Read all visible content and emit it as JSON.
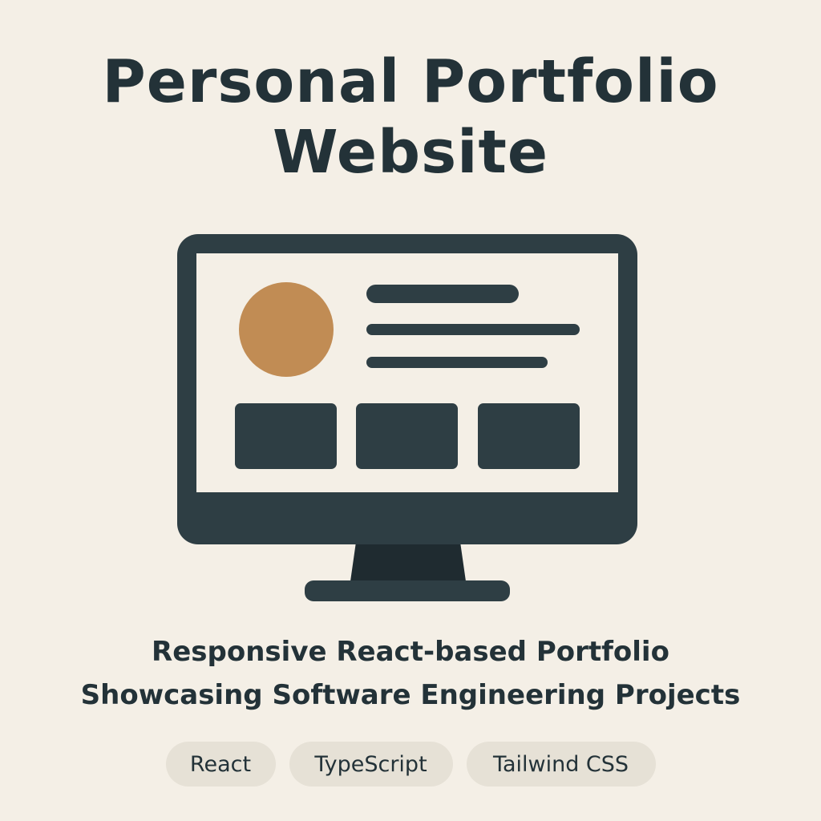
{
  "title": {
    "line1": "Personal Portfolio",
    "line2": "Website"
  },
  "subtitle": {
    "line1": "Responsive React-based Portfolio",
    "line2": "Showcasing Software Engineering Projects"
  },
  "tags": [
    "React",
    "TypeScript",
    "Tailwind CSS"
  ],
  "illustration": {
    "icon": "desktop-monitor-icon",
    "colors": {
      "frame": "#2e3e44",
      "screen": "#f4efe6",
      "avatar": "#c18c54",
      "stand_neck": "#1f2b30"
    }
  },
  "colors": {
    "background": "#f4efe6",
    "text": "#233238",
    "tag_background": "#e6e1d6"
  }
}
